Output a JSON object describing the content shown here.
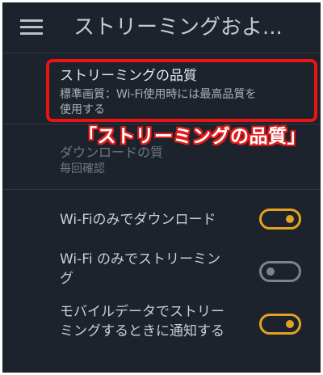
{
  "header": {
    "title": "ストリーミングおよ..."
  },
  "streaming_quality": {
    "label": "ストリーミングの品質",
    "value_line1": "標準画質：Wi-Fi使用時には最高品質を",
    "value_line2": "使用する"
  },
  "annotation": {
    "callout": "「ストリーミングの品質」",
    "color": "#e11a1a"
  },
  "download_quality": {
    "label": "ダウンロードの質",
    "value": "毎回確認"
  },
  "settings": [
    {
      "line1": "Wi-Fiのみでダウンロード",
      "line2": "",
      "on": true
    },
    {
      "line1": "Wi-Fi のみでストリーミン",
      "line2": "グ",
      "on": false
    },
    {
      "line1": "モバイルデータでストリー",
      "line2": "ミングするときに通知する",
      "on": true
    }
  ],
  "colors": {
    "accent_on": "#e5a221",
    "toggle_off": "#7c838b",
    "background": "#1c232c"
  }
}
